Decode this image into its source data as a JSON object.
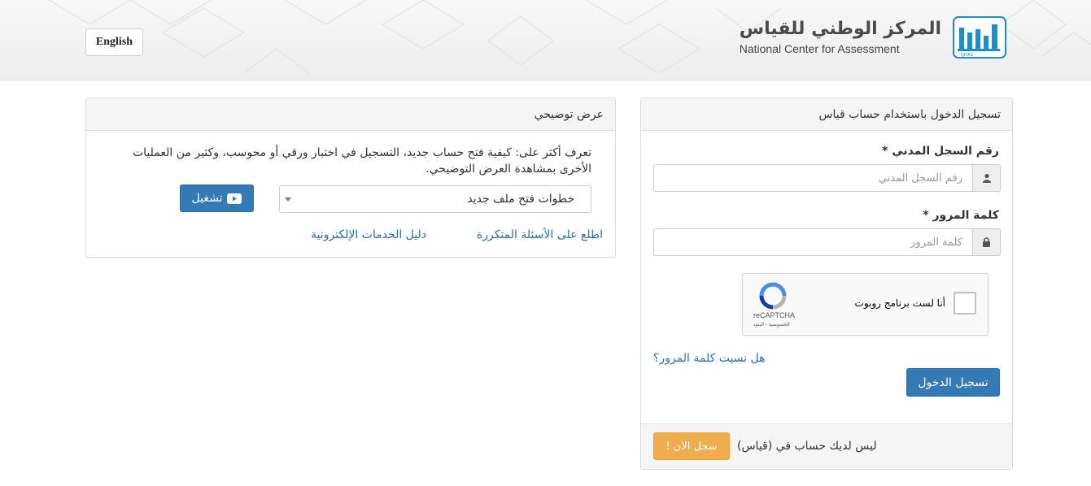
{
  "header": {
    "language_button": "English",
    "brand_arabic": "المركز الوطني للقياس",
    "brand_english": "National Center for Assessment",
    "logo_mark": "قياس",
    "logo_small": "QIYAS"
  },
  "login": {
    "title": "تسجيل الدخول باستخدام حساب قياس",
    "id_label": "رقم السجل المدني *",
    "id_placeholder": "رقم السجل المدني",
    "password_label": "كلمة المرور *",
    "password_placeholder": "كلمة المرور",
    "captcha_text": "أنا لست برنامج روبوت",
    "captcha_brand": "reCAPTCHA",
    "captcha_terms": "الخصوصية - البنود",
    "forgot_link": "هل نسيت كلمة المرور؟",
    "submit_button": "تسجيل الدخول",
    "no_account_text": "ليس لديك حساب في (قياس)",
    "register_button": "سجل الان !"
  },
  "demo": {
    "title": "عرض توضيحي",
    "description": "تعرف أكثر على: كيفية فتح حساب جديد، التسجيل في اختبار ورقي أو محوسب، وكثير من العمليات الأخرى بمشاهدة العرض التوضيحي.",
    "select_value": "خطوات فتح ملف جديد",
    "play_button": "تشغيل",
    "faq_link": "اطلع على الأسئلة المتكررة",
    "guide_link": "دليل الخدمات الإلكترونية"
  },
  "colors": {
    "primary": "#337ab7",
    "warning": "#f0ad4e",
    "link": "#2a6fb0",
    "brand_blue": "#1a8fc9"
  },
  "icons": [
    "user-icon",
    "lock-icon",
    "recaptcha-icon",
    "youtube-play-icon",
    "caret-down-icon"
  ]
}
